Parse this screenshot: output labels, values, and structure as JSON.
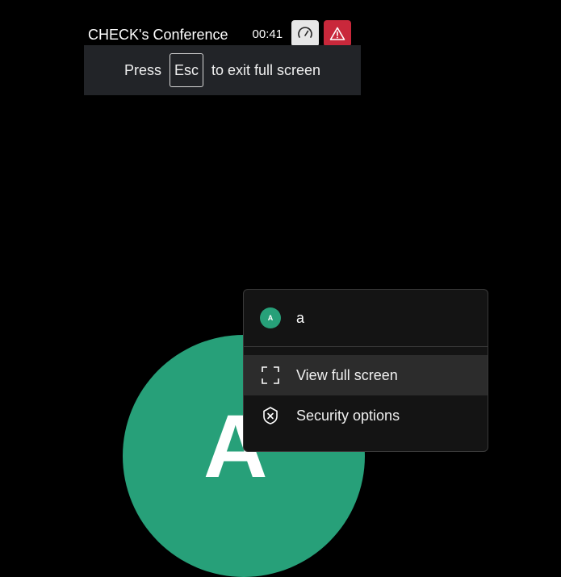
{
  "header": {
    "conference_name": "CHECK's Conference",
    "timer": "00:41"
  },
  "icons": {
    "speed": "speedometer-icon",
    "warning": "warning-icon",
    "fullscreen": "fullscreen-icon",
    "security": "shield-icon"
  },
  "colors": {
    "accent_green": "#27a079",
    "warning_red": "#c9283b"
  },
  "esc_banner": {
    "before": "Press",
    "key": "Esc",
    "after": "to exit full screen"
  },
  "participant": {
    "avatar_letter": "A",
    "initial": "A",
    "name": "a"
  },
  "menu": {
    "items": [
      {
        "label": "View full screen",
        "icon": "fullscreen-icon",
        "highlighted": true
      },
      {
        "label": "Security options",
        "icon": "shield-icon",
        "highlighted": false
      }
    ]
  }
}
